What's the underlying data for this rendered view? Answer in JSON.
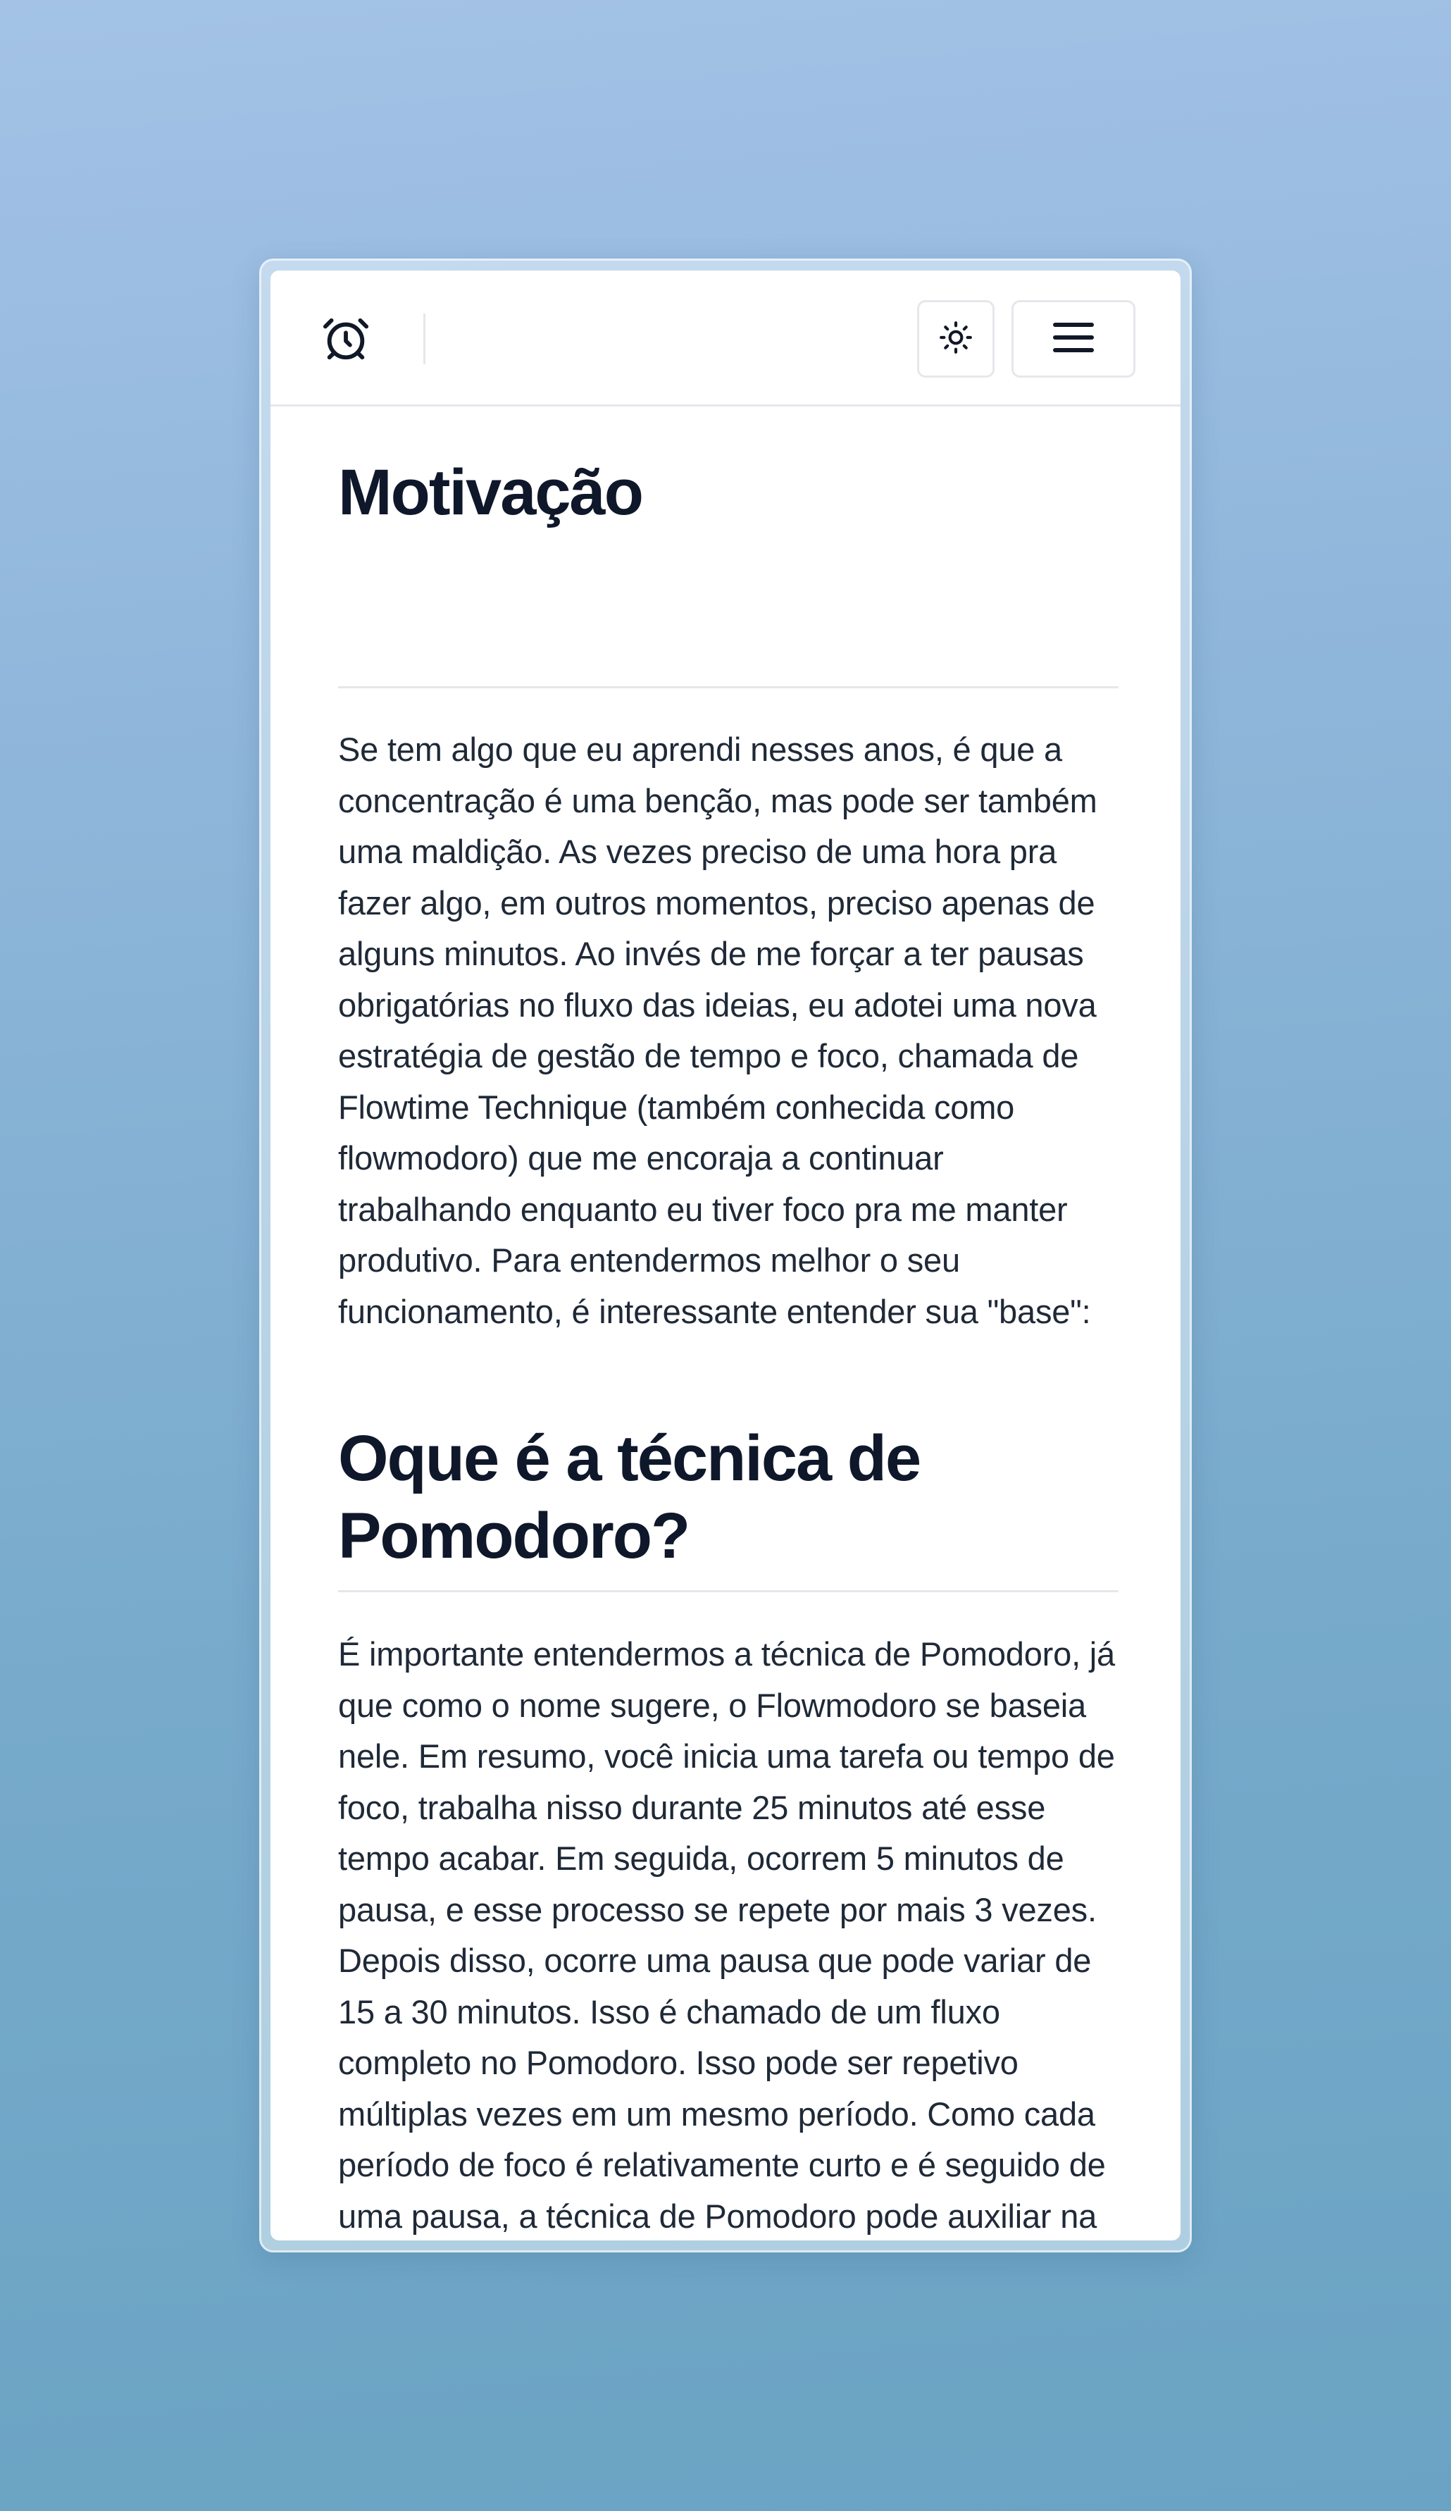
{
  "navbar": {
    "logo_icon": "alarm-clock-icon",
    "theme_icon": "sun-icon",
    "menu_icon": "hamburger-menu-icon"
  },
  "article": {
    "sections": [
      {
        "heading": "Motivação",
        "paragraph": "Se tem algo que eu aprendi nesses anos, é que a concentração é uma benção, mas pode ser também uma maldição. As vezes preciso de uma hora pra fazer algo, em outros momentos, preciso apenas de alguns minutos. Ao invés de me forçar a ter pausas obrigatórias no fluxo das ideias, eu adotei uma nova estratégia de gestão de tempo e foco, chamada de Flowtime Technique (também conhecida como flowmodoro) que me encoraja a continuar trabalhando enquanto eu tiver foco pra me manter produtivo. Para entendermos melhor o seu funcionamento, é interessante entender sua \"base\":"
      },
      {
        "heading": "Oque é a técnica de Pomodoro?",
        "paragraph": "É importante entendermos a técnica de Pomodoro, já que como o nome sugere, o Flowmodoro se baseia nele. Em resumo, você inicia uma tarefa ou tempo de foco, trabalha nisso durante 25 minutos até esse tempo acabar. Em seguida, ocorrem 5 minutos de pausa, e esse processo se repete por mais 3 vezes. Depois disso, ocorre uma pausa que pode variar de 15 a 30 minutos. Isso é chamado de um fluxo completo no Pomodoro. Isso pode ser repetivo múltiplas vezes em um mesmo período. Como cada período de foco é relativamente curto e é seguido de uma pausa, a técnica de Pomodoro pode auxiliar na realização de tarefas indesejadas ou complexas. Isso porém, gera alguns problemas:"
      }
    ]
  }
}
